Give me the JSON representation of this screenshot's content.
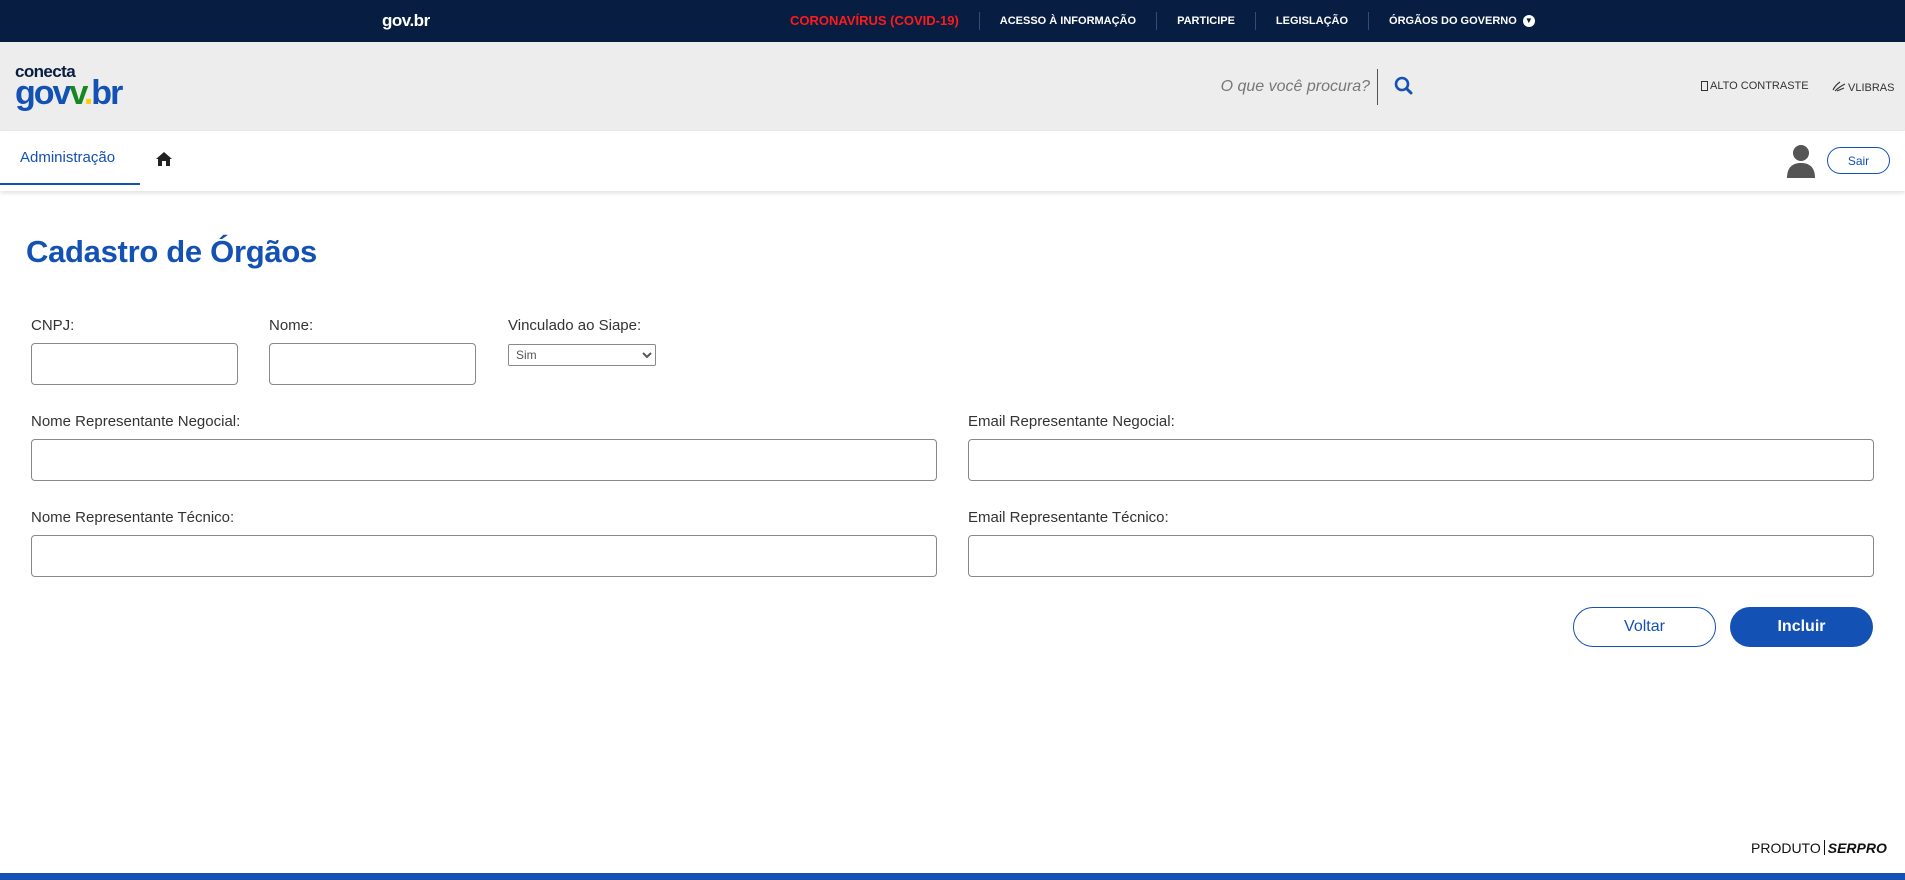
{
  "govbar": {
    "brand": "gov.br",
    "links": [
      {
        "label": "CORONAVÍRUS (COVID-19)"
      },
      {
        "label": "ACESSO À INFORMAÇÃO"
      },
      {
        "label": "PARTICIPE"
      },
      {
        "label": "LEGISLAÇÃO"
      },
      {
        "label": "ÓRGÃOS DO GOVERNO"
      }
    ]
  },
  "header": {
    "logo_top": "conecta",
    "logo_parts": [
      "gov",
      "",
      ".",
      "br"
    ],
    "search_placeholder": "O que você procura?",
    "high_contrast": "ALTO CONTRASTE",
    "libras": "VLIBRAS"
  },
  "nav": {
    "tab_label": "Administração",
    "logout_label": "Sair"
  },
  "main": {
    "title": "Cadastro de Órgãos",
    "fields": {
      "cnpj_label": "CNPJ:",
      "nome_label": "Nome:",
      "siape_label": "Vinculado ao Siape:",
      "siape_value": "Sim",
      "neg_nome_label": "Nome Representante Negocial:",
      "neg_email_label": "Email Representante Negocial:",
      "tec_nome_label": "Nome Representante Técnico:",
      "tec_email_label": "Email Representante Técnico:"
    },
    "buttons": {
      "back": "Voltar",
      "submit": "Incluir"
    }
  },
  "footer": {
    "produto": "PRODUTO",
    "serpro": "SERPRO"
  },
  "colors": {
    "govbar": "#071d41",
    "primary": "#1351b4",
    "covid": "#ff1b1b",
    "header_bg": "#ededed"
  }
}
